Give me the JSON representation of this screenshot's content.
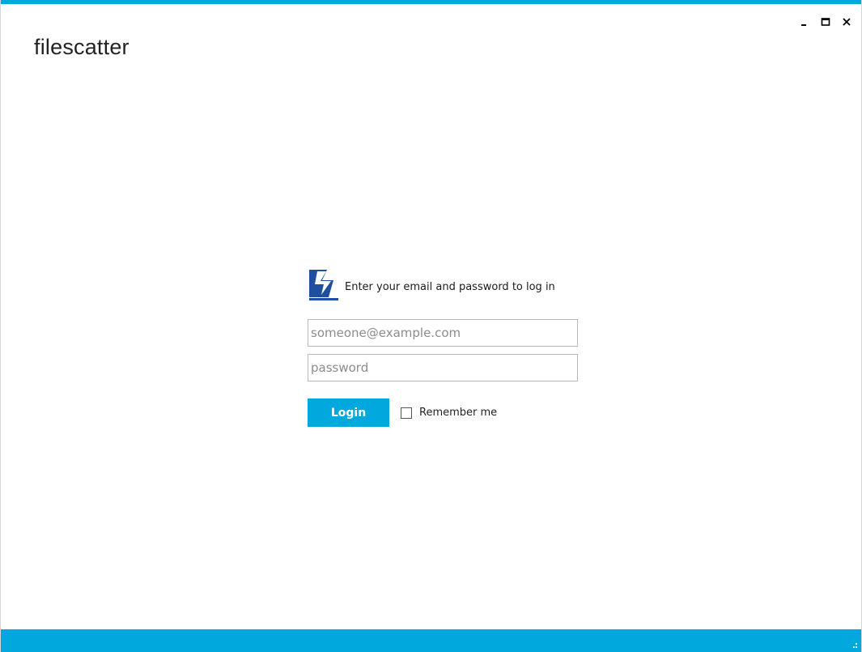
{
  "app": {
    "title": "filescatter"
  },
  "window_controls": {
    "minimize_icon": "minimize-icon",
    "maximize_icon": "maximize-icon",
    "close_icon": "close-icon"
  },
  "login": {
    "logo_icon": "filescatter-logo-icon",
    "prompt": "Enter your email and password to log in",
    "email": {
      "value": "",
      "placeholder": "someone@example.com"
    },
    "password": {
      "value": "",
      "placeholder": "password"
    },
    "login_button_label": "Login",
    "remember_me_label": "Remember me",
    "remember_me_checked": false
  },
  "colors": {
    "accent": "#00a8de",
    "logo_blue": "#1f4f9e",
    "title_text": "#222222"
  }
}
